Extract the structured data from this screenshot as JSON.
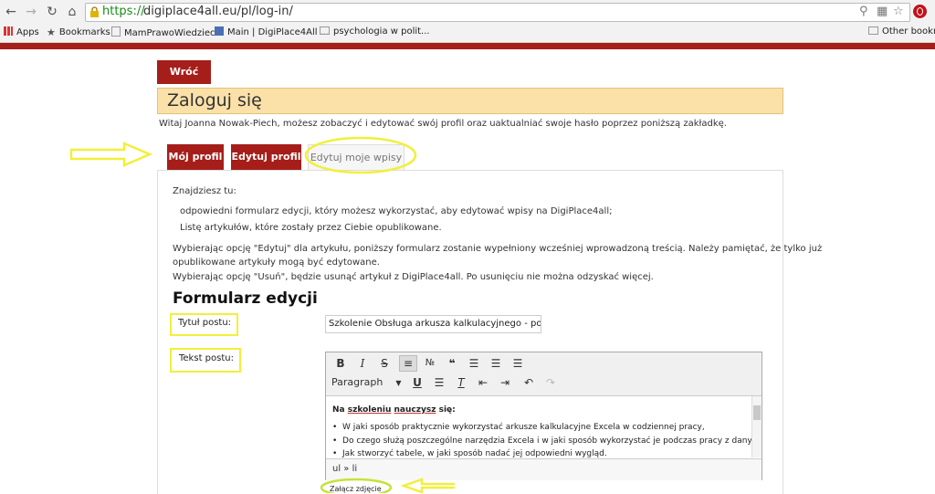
{
  "browser": {
    "url_scheme": "https://",
    "url_rest": "digiplace4all.eu/pl/log-in/",
    "bookmarks": [
      "Apps",
      "Bookmarks",
      "MamPrawoWiedziec...",
      "Main | DigiPlace4All ...",
      "psychologia w polit...",
      "Other bookmar"
    ]
  },
  "page": {
    "back_label": "Wróć",
    "title": "Zaloguj się",
    "welcome": "Witaj Joanna Nowak-Piech, możesz zobaczyć i edytować swój profil oraz uaktualniać swoje hasło poprzez poniższą zakładkę."
  },
  "tabs": [
    "Mój profil",
    "Edytuj profil",
    "Edytuj moje wpisy"
  ],
  "panel": {
    "intro": "Znajdziesz tu:",
    "item1": "odpowiedni formularz edycji, który możesz wykorzystać, aby edytować wpisy na DigiPlace4all;",
    "item2": "Listę artykułów, które zostały przez Ciebie opublikowane.",
    "para1_line1": "Wybierając opcję \"Edytuj\" dla artykułu, poniższy formularz zostanie wypełniony wcześniej wprowadzoną treścią. Należy pamiętać, że tylko już",
    "para1_line2": "opublikowane artykuły mogą być edytowane.",
    "para2": "Wybierając opcję \"Usuń\", będzie usunąć artykuł z DigiPlace4all. Po usunięciu nie można odzyskać więcej.",
    "form_title": "Formularz edycji",
    "post_title_label": "Tytuł postu:",
    "post_title_value": "Szkolenie Obsługa arkusza kalkulacyjnego - poziom",
    "post_text_label": "Tekst postu:",
    "attach_label": "Załącz zdjęcie"
  },
  "editor": {
    "format": "Paragraph",
    "heading_bold": "Na",
    "heading_u1": "szkoleniu",
    "heading_u2": "nauczysz",
    "heading_end": "się:",
    "bullets": [
      "W jaki sposób praktycznie wykorzystać arkusze kalkulacyjne Excela w codziennej pracy,",
      "Do czego służą poszczególne narzędzia Excela i w jaki sposób wykorzystać je podczas pracy z danymi,",
      "Jak stworzyć tabele, w jaki sposób nadać jej odpowiedni wygląd."
    ],
    "path": "ul » li"
  },
  "colors": {
    "brand_red": "#a61e1a",
    "title_bg": "#fbe1a8",
    "annotation_yellow": "#f2ef3a"
  }
}
